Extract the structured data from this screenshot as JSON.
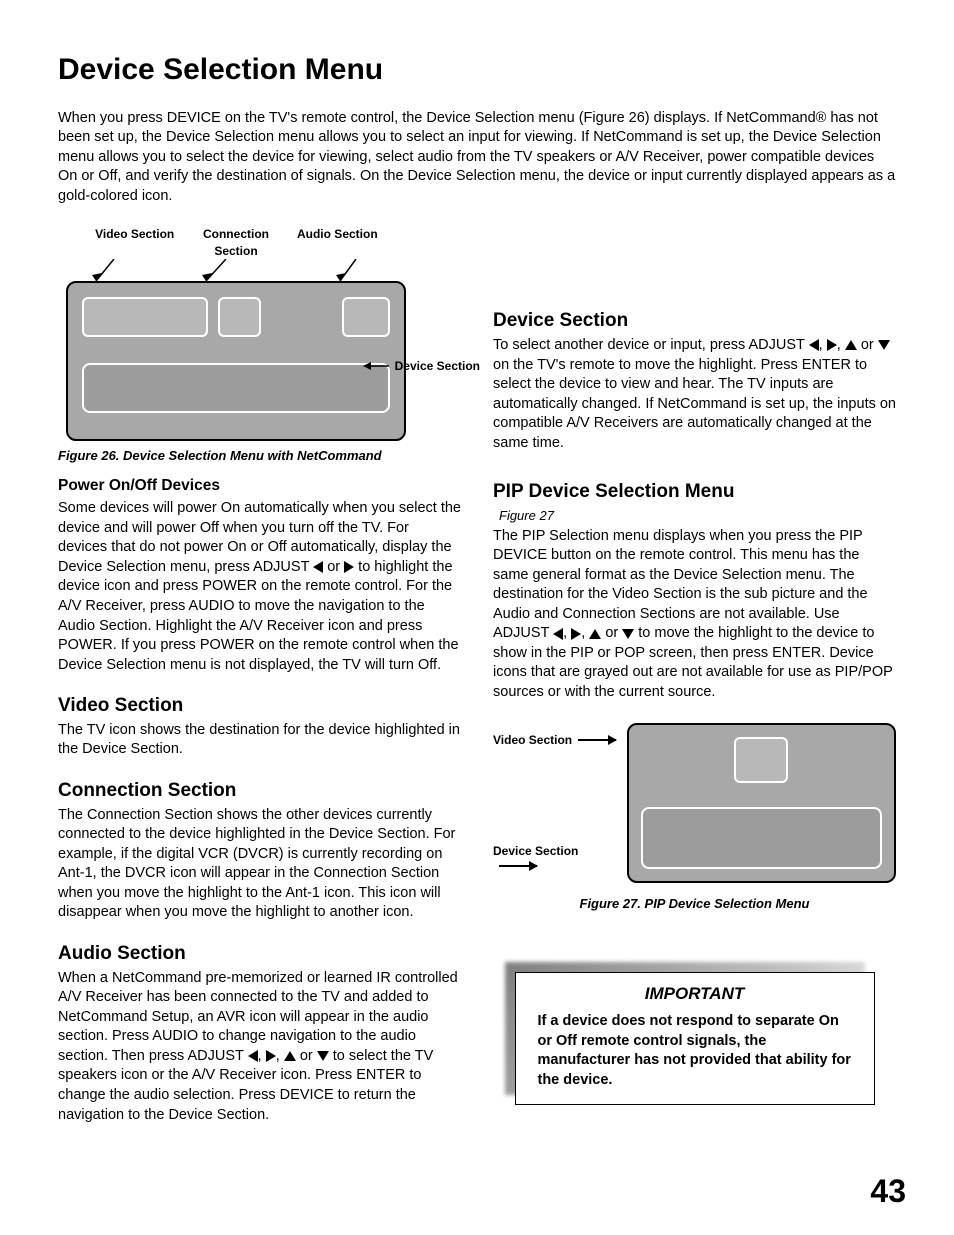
{
  "title": "Device Selection Menu",
  "intro": "When you press DEVICE on the TV's remote control, the Device Selection menu (Figure 26) displays.  If NetCommand® has not been set up, the Device Selection menu allows you to select an input for viewing.  If NetCommand is set up, the Device Selection menu allows you to select the device for viewing, select audio from the TV speakers or A/V Receiver, power compatible devices On or Off, and verify the destination of signals. On the Device Selection menu, the device or input currently displayed appears as a gold-colored icon.",
  "fig26": {
    "labels": {
      "video": "Video Section",
      "connection": "Connection Section",
      "audio": "Audio Section",
      "device": "Device Section"
    },
    "caption": "Figure 26. Device Selection Menu with NetCommand"
  },
  "power": {
    "heading": "Power On/Off Devices",
    "body_a": "Some devices will power On automatically when you select the device and will power Off when you turn off the TV.  For devices that do not power On or Off automatically, display the Device Selection menu, press ADJUST ",
    "body_b": "  to highlight the device icon and press POWER on the remote control.  For the A/V Receiver, press AUDIO to move the navigation to the Audio Section.  Highlight the  A/V Receiver icon and press POWER.  If you press POWER on the remote control when the Device Selection menu is not displayed, the TV will turn Off."
  },
  "video": {
    "heading": "Video Section",
    "body": "The TV icon shows the destination for the device highlighted in the Device Section."
  },
  "connection": {
    "heading": "Connection Section",
    "body": "The Connection Section shows the other devices currently connected to the device highlighted in the Device Section.  For example, if the digital VCR (DVCR) is currently recording on Ant-1, the DVCR icon will appear in the Connection Section when you move the highlight to the Ant-1 icon.  This icon will disappear when you move the highlight to another icon."
  },
  "audio": {
    "heading": "Audio Section",
    "body_a": "When a NetCommand pre-memorized or learned IR controlled A/V Receiver has been connected to the TV and added to NetCommand Setup, an AVR icon will appear in the audio section.  Press AUDIO  to change navigation to the audio section.  Then press ADJUST ",
    "body_b": " to select the TV speakers icon or the A/V Receiver icon.  Press ENTER to change the audio selection.  Press DEVICE to return the navigation to the Device Section."
  },
  "device": {
    "heading": "Device Section",
    "body_a": "To select another device or input, press ADJUST ",
    "body_b": "  on the TV's remote to move the highlight.  Press ENTER to select the device to view and hear.  The TV inputs are automatically changed.  If NetCommand is set up, the inputs on compatible A/V Receivers are automatically changed at the same time."
  },
  "pip": {
    "heading": "PIP Device Selection Menu",
    "subcaption": "Figure 27",
    "body_a": "The PIP Selection menu displays when you press the PIP DEVICE button on the remote control.  This menu has the same general format as the Device Selection menu.  The destination for the Video Section is the sub picture and the Audio and Connection Sections are not available.  Use ADJUST ",
    "body_b": "  to move the highlight to the device to show in the PIP or POP screen, then press ENTER.  Device icons that are grayed out are not available for use as PIP/POP sources or with the current source."
  },
  "fig27": {
    "labels": {
      "video": "Video Section",
      "device": "Device Section"
    },
    "caption": "Figure 27. PIP Device Selection Menu"
  },
  "important": {
    "title": "IMPORTANT",
    "body": "If a device does not respond to separate On or Off remote control signals, the manufacturer has not provided that ability for the device."
  },
  "or_word": " or ",
  "page_number": "43"
}
